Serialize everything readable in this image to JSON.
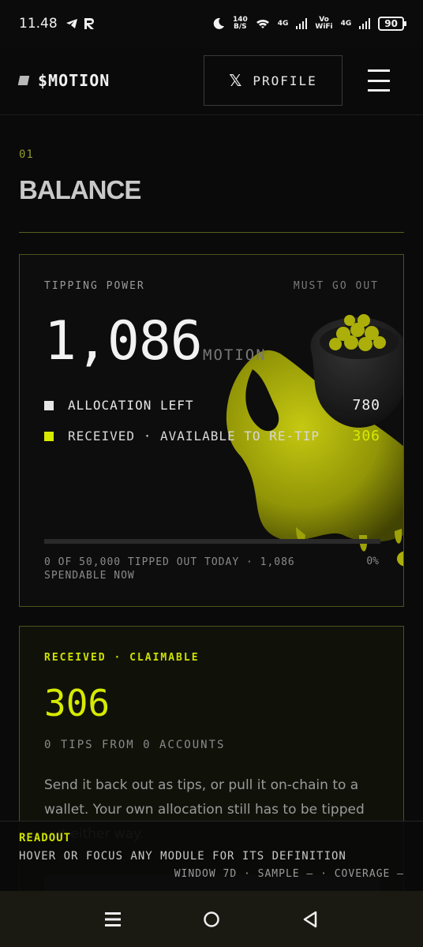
{
  "status_bar": {
    "time": "11.48",
    "net_speed_value": "140",
    "net_speed_unit": "B/S",
    "net1": "4G",
    "vowifi_top": "Vo",
    "vowifi_bottom": "WiFi",
    "net2": "4G",
    "battery": "90"
  },
  "header": {
    "brand": "$MOTION",
    "profile_label": "PROFILE",
    "x_glyph": "𝕏"
  },
  "section": {
    "number": "01",
    "title": "BALANCE"
  },
  "tipping_card": {
    "label": "TIPPING POWER",
    "tag": "MUST GO OUT",
    "amount": "1,086",
    "unit": "MOTION",
    "rows": [
      {
        "label": "ALLOCATION LEFT",
        "value": "780",
        "color": "#e6e6e6"
      },
      {
        "label": "RECEIVED · AVAILABLE TO RE-TIP",
        "value": "306",
        "color": "#d6ea00"
      }
    ],
    "tipped_fraction": 0,
    "footer": "0 OF 50,000 TIPPED OUT TODAY · 1,086 SPENDABLE NOW",
    "percent": "0%"
  },
  "received_card": {
    "label": "RECEIVED · CLAIMABLE",
    "amount": "306",
    "tips": "0 TIPS FROM 0 ACCOUNTS",
    "body": "Send it back out as tips, or pull it on-chain to a wallet. Your own allocation still has to be tipped out either way."
  },
  "readout": {
    "title": "READOUT",
    "text": "HOVER OR FOCUS ANY MODULE FOR ITS DEFINITION",
    "meta": "WINDOW 7D · SAMPLE — · COVERAGE —"
  },
  "colors": {
    "accent": "#d6ea00",
    "border": "#4e531a",
    "background": "#0a0a0a"
  },
  "nav": {
    "icons": [
      "recents-icon",
      "home-icon",
      "back-icon"
    ]
  }
}
